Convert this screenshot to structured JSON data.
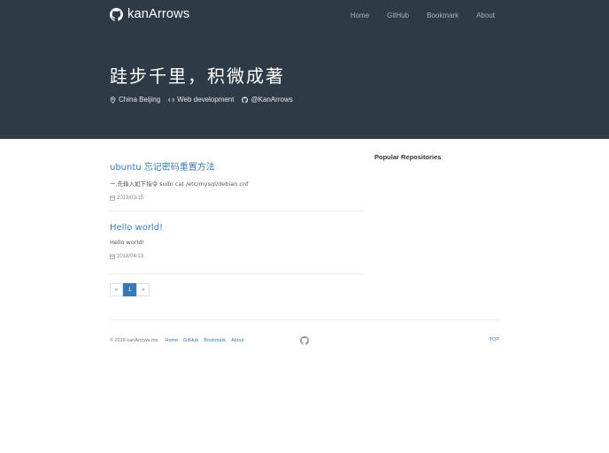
{
  "header": {
    "brand": "kanArrows",
    "nav": [
      "Home",
      "GitHub",
      "Bookmark",
      "About"
    ],
    "tagline": "跬步千里，积微成著",
    "location": "China Beijing",
    "profession": "Web development",
    "github_handle": "@KanArrows"
  },
  "posts": [
    {
      "title": "ubuntu 忘记密码重置方法",
      "excerpt": "一.先输入如下指令 sudo cat /etc/mysql/debian.cnf",
      "date": "2019/03/15"
    },
    {
      "title": "Hello world!",
      "excerpt": "Hello world!",
      "date": "2018/04/13"
    }
  ],
  "pagination": {
    "prev": "«",
    "current": "1",
    "next": "»"
  },
  "sidebar": {
    "title": "Popular Repositories"
  },
  "footer": {
    "copyright": "© 2018 kanArrows.me",
    "links": [
      "Home",
      "GitHub",
      "Bookmark",
      "About"
    ],
    "top": "TOP"
  },
  "colors": {
    "header_bg": "#2f3a47",
    "link": "#3c7bb5",
    "active_page": "#337ab7"
  },
  "icons": [
    "github-icon",
    "location-pin-icon",
    "code-icon",
    "calendar-icon"
  ]
}
